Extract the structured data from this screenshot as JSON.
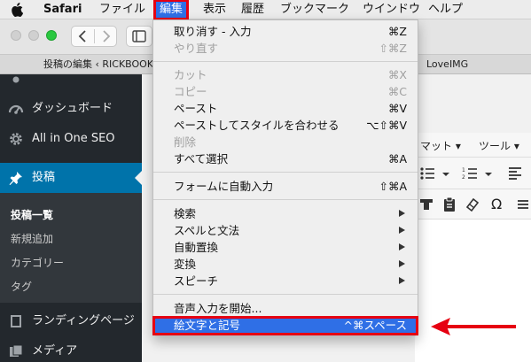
{
  "menubar": {
    "app": "Safari",
    "items": [
      "ファイル",
      "編集",
      "表示",
      "履歴",
      "ブックマーク",
      "ウインドウ",
      "ヘルプ"
    ],
    "active_index": 1
  },
  "tabs": {
    "left_title": "投稿の編集 ‹ RICKBOOK —",
    "right_title": "LoveIMG"
  },
  "sidebar": {
    "items": [
      {
        "label": "ダッシュボード",
        "icon": "dashboard-icon"
      },
      {
        "label": "All in One SEO",
        "icon": "gear-icon"
      },
      {
        "label": "投稿",
        "icon": "pin-icon"
      },
      {
        "label": "ランディングページ",
        "icon": "page-icon"
      },
      {
        "label": "メディア",
        "icon": "media-icon"
      }
    ],
    "submenu": [
      "投稿一覧",
      "新規追加",
      "カテゴリー",
      "タグ"
    ]
  },
  "editor": {
    "format_label": "マット ▾",
    "tools_label": "ツール ▾",
    "omega": "Ω"
  },
  "edit_menu": {
    "items": [
      {
        "label": "取り消す - 入力",
        "shortcut": "⌘Z",
        "disabled": false
      },
      {
        "label": "やり直す",
        "shortcut": "⇧⌘Z",
        "disabled": true
      },
      {
        "label": "カット",
        "shortcut": "⌘X",
        "disabled": true
      },
      {
        "label": "コピー",
        "shortcut": "⌘C",
        "disabled": true
      },
      {
        "label": "ペースト",
        "shortcut": "⌘V",
        "disabled": false
      },
      {
        "label": "ペーストしてスタイルを合わせる",
        "shortcut": "⌥⇧⌘V",
        "disabled": false
      },
      {
        "label": "削除",
        "shortcut": "",
        "disabled": true
      },
      {
        "label": "すべて選択",
        "shortcut": "⌘A",
        "disabled": false
      },
      {
        "label": "フォームに自動入力",
        "shortcut": "⇧⌘A",
        "disabled": false
      },
      {
        "label": "検索",
        "submenu": true
      },
      {
        "label": "スペルと文法",
        "submenu": true
      },
      {
        "label": "自動置換",
        "submenu": true
      },
      {
        "label": "変換",
        "submenu": true
      },
      {
        "label": "スピーチ",
        "submenu": true
      },
      {
        "label": "音声入力を開始...",
        "shortcut": "",
        "disabled": false
      },
      {
        "label": "絵文字と記号",
        "shortcut": "^⌘スペース",
        "highlighted": true
      }
    ]
  },
  "colors": {
    "highlight": "#2f6fe6",
    "annotation": "#e60012",
    "wp_sidebar": "#23282d",
    "wp_active": "#0073aa"
  }
}
